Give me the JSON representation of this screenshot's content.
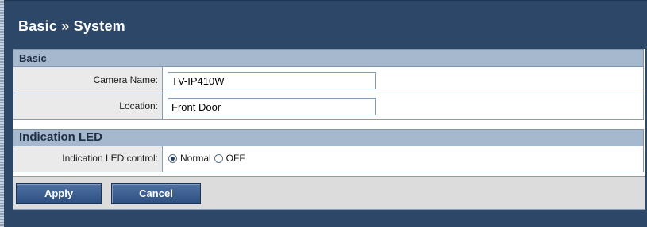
{
  "page": {
    "title": "Basic » System"
  },
  "sections": {
    "basic": {
      "heading": "Basic",
      "camera_name": {
        "label": "Camera Name:",
        "value": "TV-IP410W"
      },
      "location": {
        "label": "Location:",
        "value": "Front Door"
      }
    },
    "led": {
      "heading": "Indication LED",
      "control": {
        "label": "Indication LED control:",
        "options": [
          "Normal",
          "OFF"
        ],
        "selected": "Normal"
      }
    }
  },
  "actions": {
    "apply_label": "Apply",
    "cancel_label": "Cancel"
  },
  "colors": {
    "page_background": "#2d4769",
    "section_header": "#a6b8cd",
    "label_cell": "#eaeaea",
    "button": "#2e4f81"
  }
}
